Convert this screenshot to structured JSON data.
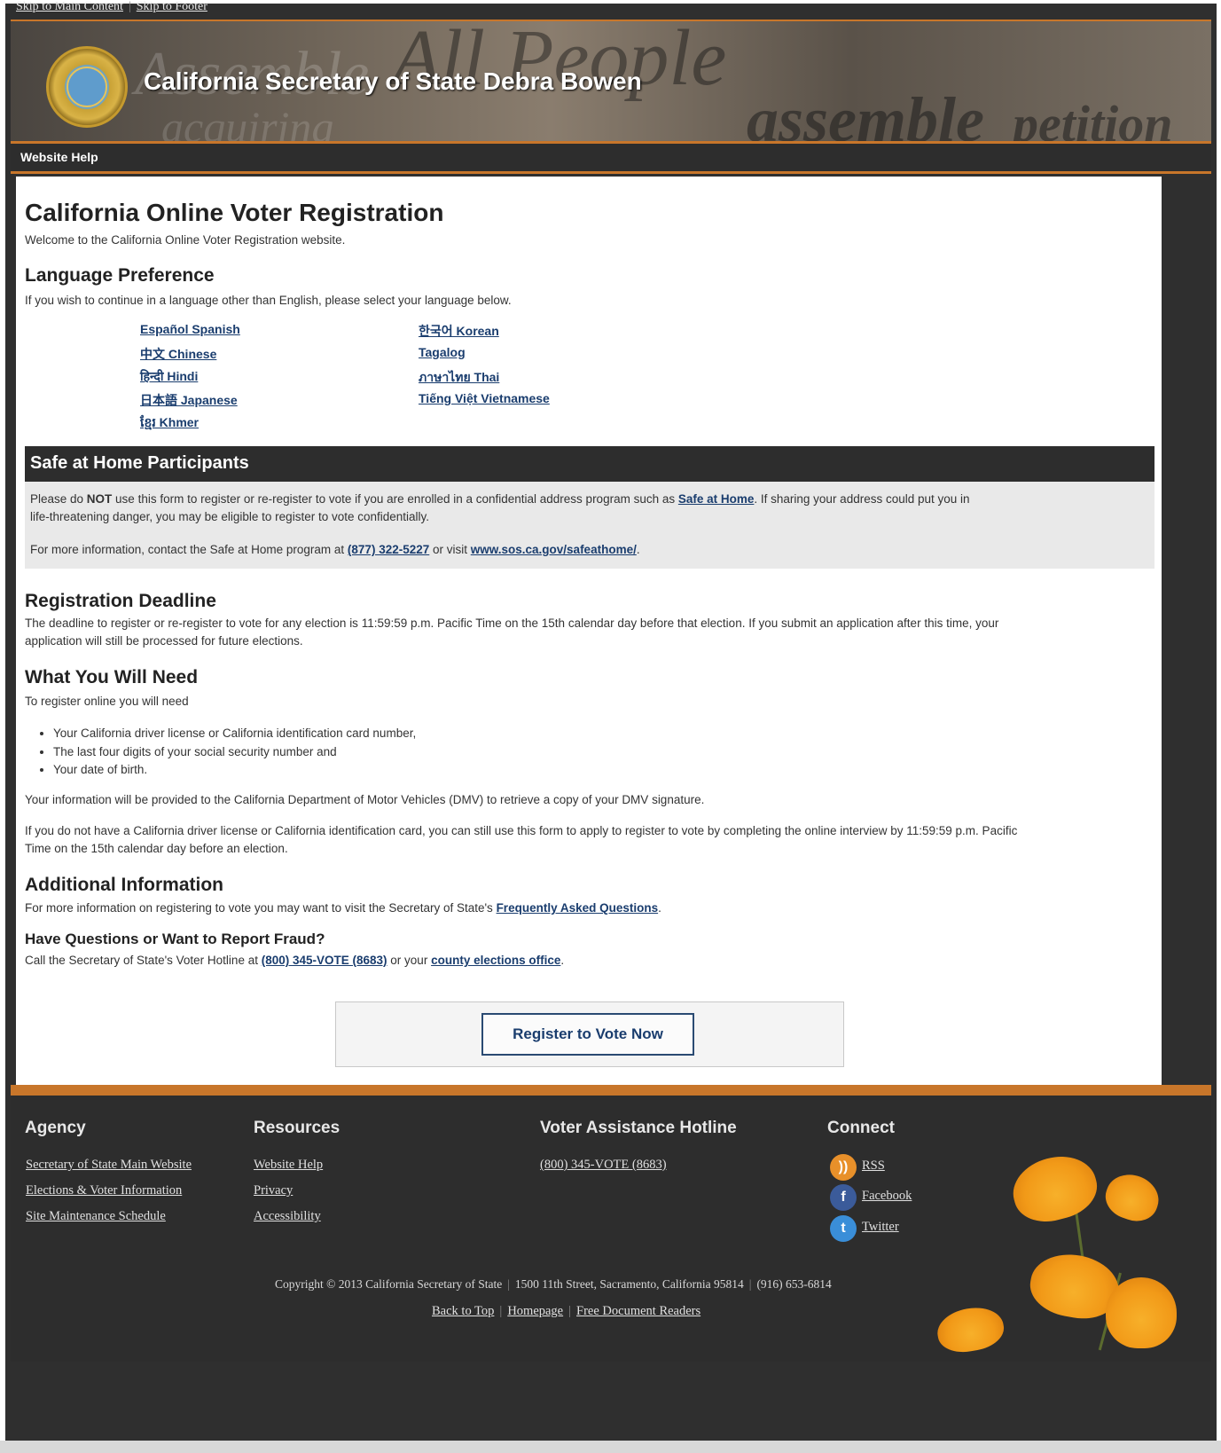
{
  "skip_links": {
    "main": "Skip to Main Content",
    "footer": "Skip to Footer"
  },
  "banner": {
    "title": "California Secretary of State Debra Bowen"
  },
  "nav": {
    "help": "Website Help"
  },
  "page": {
    "title": "California Online Voter Registration",
    "welcome": "Welcome to the California Online Voter Registration website.",
    "language": {
      "heading": "Language Preference",
      "intro": "If you wish to continue in a language other than English, please select your language below.",
      "left": [
        "Español Spanish",
        "中文 Chinese",
        "हिन्दी Hindi",
        "日本語 Japanese",
        "ខ្មែរ Khmer"
      ],
      "right": [
        "한국어 Korean",
        "Tagalog",
        "ภาษาไทย Thai",
        "Tiếng Việt Vietnamese"
      ]
    },
    "safe": {
      "heading": "Safe at Home Participants",
      "p1_a": "Please do ",
      "p1_bold": "NOT",
      "p1_b": " use this form to register or re-register to vote if you are enrolled in a confidential address program such as ",
      "p1_link": "Safe at Home",
      "p1_c": ". If sharing your address could put you in",
      "p1_d": "life-threatening danger, you may be eligible to register to vote confidentially.",
      "p2_a": "For more information, contact the Safe at Home program at ",
      "p2_phone": "(877) 322-5227",
      "p2_b": " or visit ",
      "p2_url": "www.sos.ca.gov/safeathome/",
      "p2_c": "."
    },
    "deadline": {
      "heading": "Registration Deadline",
      "line1": "The deadline to register or re-register to vote for any election is 11:59:59 p.m. Pacific Time on the 15th calendar day before that election. If you submit an application after this time, your",
      "line2": "application will still be processed for future elections."
    },
    "need": {
      "heading": "What You Will Need",
      "intro": "To register online you will need",
      "items": [
        "Your California driver license or California identification card number,",
        "The last four digits of your social security number and",
        "Your date of birth."
      ],
      "p1": "Your information will be provided to the California Department of Motor Vehicles (DMV) to retrieve a copy of your DMV signature.",
      "p2_l1": "If you do not have a California driver license or California identification card, you can still use this form to apply to register to vote by completing the online interview by 11:59:59 p.m. Pacific",
      "p2_l2": "Time on the 15th calendar day before an election."
    },
    "additional": {
      "heading": "Additional Information",
      "text": "For more information on registering to vote you may want to visit the Secretary of State's ",
      "link": "Frequently Asked Questions",
      "end": "."
    },
    "fraud": {
      "heading": "Have Questions or Want to Report Fraud?",
      "text_a": "Call the Secretary of State's Voter Hotline at ",
      "phone": "(800) 345-VOTE (8683)",
      "text_b": " or your ",
      "link": "county elections office",
      "end": "."
    },
    "register_button": "Register to Vote Now"
  },
  "footer": {
    "agency": {
      "heading": "Agency",
      "links": [
        "Secretary of State Main Website",
        "Elections & Voter Information",
        "Site Maintenance Schedule"
      ]
    },
    "resources": {
      "heading": "Resources",
      "links": [
        "Website Help",
        "Privacy",
        "Accessibility"
      ]
    },
    "hotline": {
      "heading": "Voter Assistance Hotline",
      "phone": "(800) 345-VOTE (8683)"
    },
    "connect": {
      "heading": "Connect",
      "links": [
        "RSS",
        "Facebook",
        "Twitter"
      ]
    },
    "copyright": "Copyright © 2013 California Secretary of State",
    "address": "1500 11th Street, Sacramento, California 95814",
    "phone": "(916) 653-6814",
    "bottom_links": [
      "Back to Top",
      "Homepage",
      "Free Document Readers"
    ]
  },
  "colors": {
    "accent": "#c8762a",
    "link": "#1a3d6e",
    "dark": "#2d2d2d",
    "rss": "#e8902a",
    "facebook": "#3b5b9a",
    "twitter": "#3a8ed8"
  }
}
